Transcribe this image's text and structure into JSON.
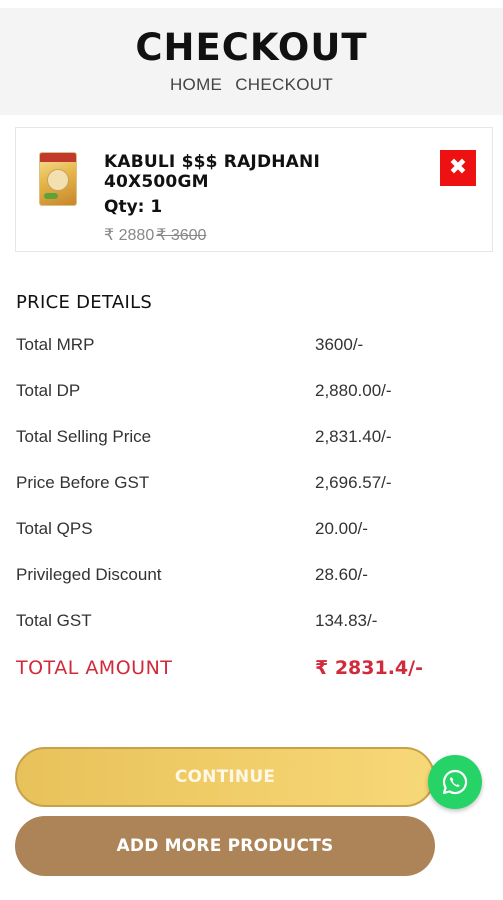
{
  "header": {
    "title": "CHECKOUT",
    "breadcrumb": [
      "HOME",
      "CHECKOUT"
    ]
  },
  "cart": {
    "items": [
      {
        "name": "KABULI $$$ RAJDHANI 40X500GM",
        "qty": "Qty: 1",
        "price": "₹ 2880",
        "mrp": "₹ 3600",
        "image_icon": "product-packet-image",
        "remove_symbol": "✖"
      }
    ]
  },
  "price_details": {
    "heading": "PRICE DETAILS",
    "rows": [
      {
        "label": "Total MRP",
        "value": "3600/-"
      },
      {
        "label": "Total DP",
        "value": "2,880.00/-"
      },
      {
        "label": "Total Selling Price",
        "value": "2,831.40/-"
      },
      {
        "label": "Price Before GST",
        "value": "2,696.57/-"
      },
      {
        "label": "Total QPS",
        "value": "20.00/-"
      },
      {
        "label": "Privileged Discount",
        "value": "28.60/-"
      },
      {
        "label": "Total GST",
        "value": "134.83/-"
      }
    ],
    "total": {
      "label": "TOTAL AMOUNT",
      "value": "₹ 2831.4/-"
    }
  },
  "actions": {
    "continue_label": "CONTINUE",
    "add_more_label": "ADD MORE PRODUCTS"
  },
  "floating": {
    "whatsapp_icon": "whatsapp-icon"
  },
  "colors": {
    "total_red": "#d12a3a",
    "remove_red": "#ee1111",
    "continue_gold": "#f0cd68",
    "add_more_brown": "#ad8457",
    "whatsapp_green": "#25d366"
  }
}
